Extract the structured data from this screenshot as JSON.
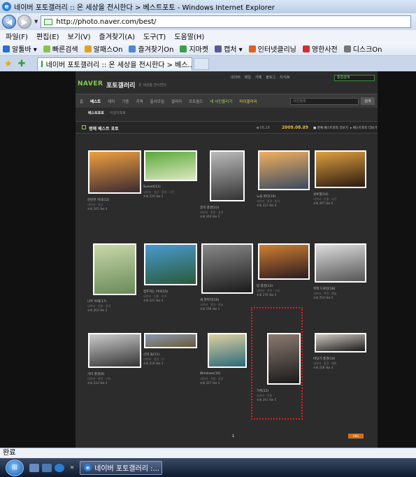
{
  "window": {
    "title": "네이버 포토갤러리 :: 온 세상을 전시한다 > 베스트포토 - Windows Internet Explorer"
  },
  "address": {
    "url": "http://photo.naver.com/best/"
  },
  "menu": [
    "파일(F)",
    "편집(E)",
    "보기(V)",
    "즐겨찾기(A)",
    "도구(T)",
    "도움말(H)"
  ],
  "toolbar": [
    {
      "label": "알툴바 ▾",
      "color": "#2b6fd0"
    },
    {
      "label": "빠른검색",
      "color": "#8bc34a"
    },
    {
      "label": "알패스On",
      "color": "#e0a020"
    },
    {
      "label": "즐겨찾기On",
      "color": "#4a8ad4"
    },
    {
      "label": "지마켓",
      "color": "#3aa04a"
    },
    {
      "label": "캡처 ▾",
      "color": "#5a5a9a"
    },
    {
      "label": "인터넷클리닝",
      "color": "#e06020"
    },
    {
      "label": "영한사전",
      "color": "#d03030"
    },
    {
      "label": "디스크On",
      "color": "#777777"
    }
  ],
  "tab": {
    "label": "네이버 포토갤러리 :: 온 세상을 전시한다 > 베스..."
  },
  "site": {
    "logo": "NAVER",
    "logo_sub": "포토갤러리",
    "logo_tag": "온 세상을 전시한다",
    "top_links": [
      "네이버",
      "메일",
      "카페",
      "블로그",
      "지식iN"
    ],
    "top_search": "통합검색",
    "nav": [
      {
        "label": "홈",
        "style": ""
      },
      {
        "label": "베스트",
        "style": "active"
      },
      {
        "label": "테마",
        "style": ""
      },
      {
        "label": "기종",
        "style": ""
      },
      {
        "label": "지역",
        "style": ""
      },
      {
        "label": "출사모임",
        "style": ""
      },
      {
        "label": "갤러리",
        "style": ""
      },
      {
        "label": "포토월드",
        "style": ""
      },
      {
        "label": "내 사진올리기",
        "style": "green"
      },
      {
        "label": "마이갤러리",
        "style": "yellow"
      }
    ],
    "nav_search_placeholder": "사진검색",
    "nav_search_button": "검색",
    "subnav": [
      {
        "label": "베스트포토",
        "on": true
      },
      {
        "label": "이달의포토",
        "on": false
      }
    ],
    "section_title": "명예 베스트 포토",
    "date_prev": "◀ 08.28",
    "date_current": "2009.08.29",
    "date_next": "▶",
    "section_right1": "■ 명예 베스트포토 더보기",
    "section_right2": "▸ 베스트포토 더보기",
    "page_number": "1",
    "page_badge": "RSS"
  },
  "photos": [
    {
      "title": "잔잔한 저녁(12)",
      "meta": "네이버 · 일상",
      "views": "조회 245 like 4",
      "colors": [
        "#f0a040",
        "#3a2a30"
      ]
    },
    {
      "title": "Sunset(11)",
      "meta": "네이버 · 일상 · 풍경 · 사진",
      "views": "조회 234 like 3",
      "colors": [
        "#5aa83a",
        "#dde8c0"
      ]
    },
    {
      "title": "골목 풍경(21)",
      "meta": "네이버 · 풍경 · 골목",
      "views": "조회 340 like 5",
      "colors": [
        "#bbbbbb",
        "#333333"
      ]
    },
    {
      "title": "노을 바다(19)",
      "meta": "네이버 · 풍경 · 바다",
      "views": "조회 312 like 4",
      "colors": [
        "#f0b060",
        "#3a4a60"
      ]
    },
    {
      "title": "실루엣(14)",
      "meta": "네이버 · 인물 · 사진",
      "views": "조회 287 like 6",
      "colors": [
        "#e0a040",
        "#2a1a10"
      ]
    },
    {
      "title": "나무 아래(17)",
      "meta": "네이버 · 인물 · 풍경",
      "views": "조회 263 like 3",
      "colors": [
        "#c8d8a8",
        "#6a8a5a"
      ]
    },
    {
      "title": "점프하는 아이(15)",
      "meta": "네이버 · 인물 · 아이",
      "views": "조회 221 like 4",
      "colors": [
        "#4a9ad0",
        "#2a5a3a"
      ]
    },
    {
      "title": "새 한마리(10)",
      "meta": "네이버 · 풍경 · 하늘",
      "views": "조회 198 like 2",
      "colors": [
        "#888888",
        "#1a1a1a"
      ]
    },
    {
      "title": "밤 풍경(13)",
      "meta": "네이버 · 야경 · 거리",
      "views": "조회 276 like 5",
      "colors": [
        "#d08030",
        "#2a1a20"
      ]
    },
    {
      "title": "흑백 드로잉(18)",
      "meta": "네이버 · 흑백 · 예술",
      "views": "조회 254 like 4",
      "colors": [
        "#dddddd",
        "#555555"
      ]
    },
    {
      "title": "거리 풍경(9)",
      "meta": "네이버 · 흑백 · 거리",
      "views": "조회 233 like 3",
      "colors": [
        "#cccccc",
        "#333333"
      ]
    },
    {
      "title": "산과 들(11)",
      "meta": "네이버 · 풍경 · 산",
      "views": "조회 219 like 3",
      "colors": [
        "#8a9ab0",
        "#6a5a3a"
      ]
    },
    {
      "title": "Windows(16)",
      "meta": "네이버 · 건물 · 창문",
      "views": "조회 267 like 4",
      "colors": [
        "#e0d0a0",
        "#2a6a7a"
      ]
    },
    {
      "title": "가족(12)",
      "meta": "네이버 · 인물",
      "views": "조회 241 like 5",
      "colors": [
        "#8a7a70",
        "#1a1a1a"
      ]
    },
    {
      "title": "바닷가 풍경(14)",
      "meta": "네이버 · 풍경 · 해변",
      "views": "조회 258 like 4",
      "colors": [
        "#d0c8c0",
        "#1a1a1a"
      ]
    }
  ],
  "status": {
    "text": "완료"
  },
  "taskbar": {
    "window_label": "네이버 포토갤러리 :..."
  }
}
